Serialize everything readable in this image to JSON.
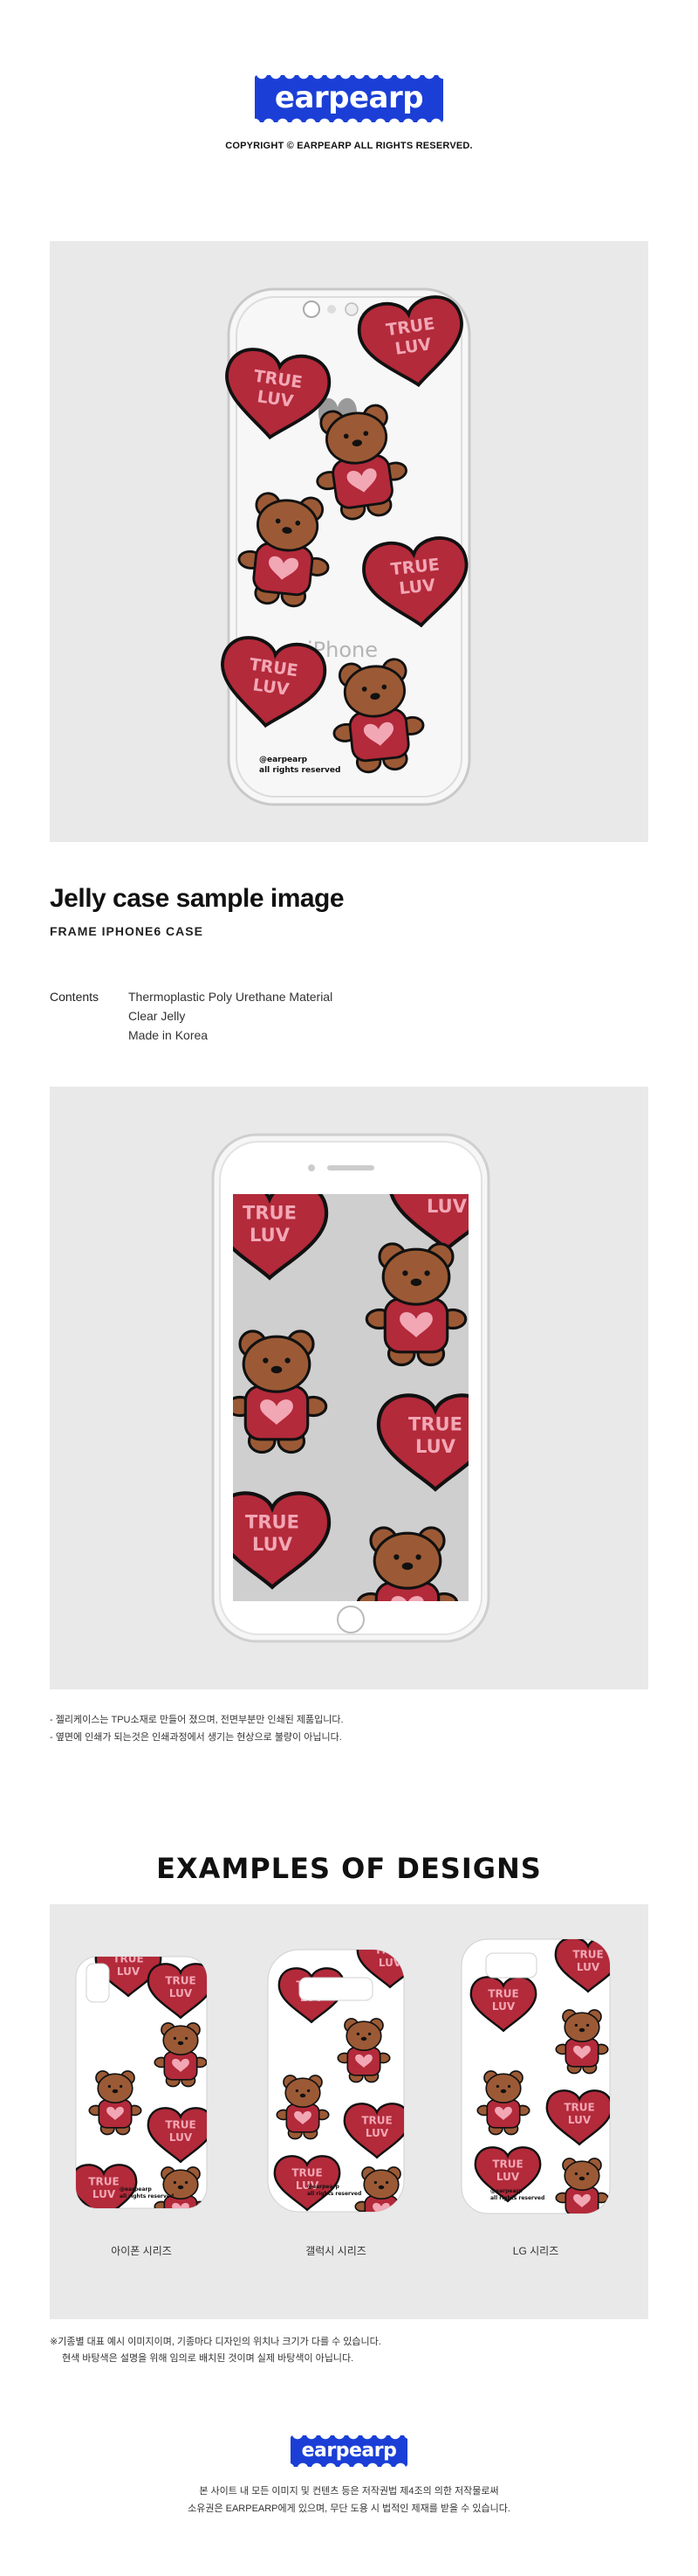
{
  "brand": {
    "logo": "earpearp",
    "copyright": "COPYRIGHT © EARPEARP ALL RIGHTS RESERVED."
  },
  "design": {
    "heart_text": "TRUE LUV",
    "heart_color": "#b32a3a",
    "bear_color": "#9b5a35",
    "shirt_color": "#b32a3a"
  },
  "case_print": {
    "line1": "@earpearp",
    "line2": "all rights reserved"
  },
  "phone_brand": "iPhone",
  "product": {
    "title": "Jelly case sample image",
    "subtitle": "FRAME IPHONE6 CASE",
    "contents_label": "Contents",
    "contents": [
      "Thermoplastic Poly Urethane Material",
      "Clear Jelly",
      "Made in Korea"
    ]
  },
  "notes": [
    "- 젤리케이스는 TPU소재로 만들어 졌으며, 전면부분만 인쇄된 제품입니다.",
    "- 옆면에 인쇄가 되는것은 인쇄과정에서 생기는 현상으로 불량이 아닙니다."
  ],
  "examples": {
    "heading": "EXAMPLES OF DESIGNS",
    "series": [
      "아이폰 시리즈",
      "갤럭시 시리즈",
      "LG 시리즈"
    ],
    "disclaimer": [
      "※기종별 대표 예시 이미지이며, 기종마다 디자인의 위치나 크기가 다를 수 있습니다.",
      "현색 바탕색은 설명을 위해 임의로 배치된 것이며 실제 바탕색이 아닙니다."
    ]
  },
  "footer": {
    "logo": "earpearp",
    "lines": [
      "본 사이트 내 모든 이미지 및 컨텐츠 등은 저작권법 제4조의 의한 저작물로써",
      "소유권은 EARPEARP에게 있으며, 무단 도용 시 법적인 제재를 받을 수 있습니다."
    ]
  }
}
